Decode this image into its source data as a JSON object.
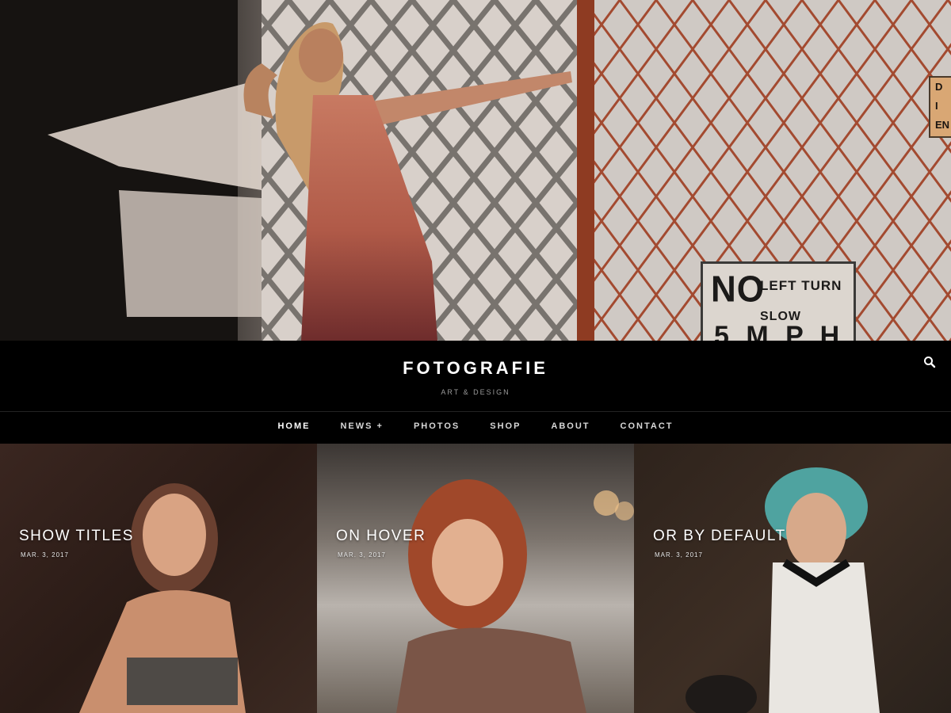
{
  "hero": {
    "sign": {
      "line1": "NO",
      "line2": "LEFT TURN",
      "line3": "SLOW",
      "line4": "5 M P H"
    },
    "side_sign": {
      "line1": "D",
      "line2": "I",
      "line3": "EN"
    }
  },
  "header": {
    "title": "FOTOGRAFIE",
    "tagline": "ART & DESIGN",
    "search_icon": "search-icon"
  },
  "nav": {
    "items": [
      {
        "label": "HOME",
        "active": true
      },
      {
        "label": "NEWS +",
        "active": false
      },
      {
        "label": "PHOTOS",
        "active": false
      },
      {
        "label": "SHOP",
        "active": false
      },
      {
        "label": "ABOUT",
        "active": false
      },
      {
        "label": "CONTACT",
        "active": false
      }
    ]
  },
  "posts": [
    {
      "title": "SHOW TITLES",
      "date": "MAR. 3, 2017"
    },
    {
      "title": "ON HOVER",
      "date": "MAR. 3, 2017"
    },
    {
      "title": "OR BY DEFAULT",
      "date": "MAR. 3, 2017"
    }
  ],
  "colors": {
    "background": "#000000",
    "text": "#ffffff",
    "muted": "#9a9a9a"
  }
}
